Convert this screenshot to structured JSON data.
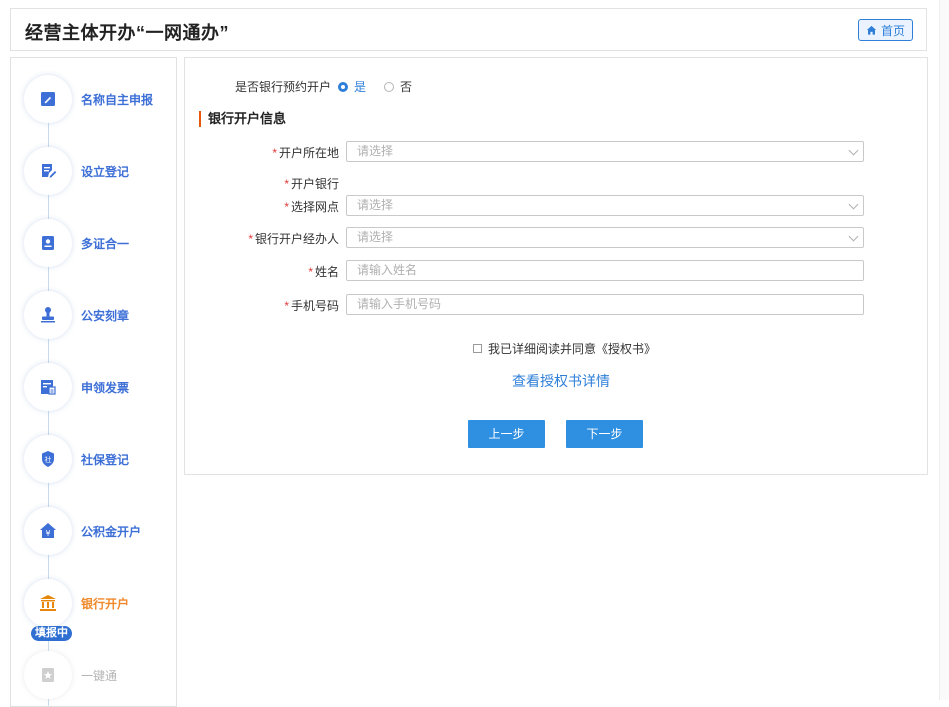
{
  "header": {
    "title": "经营主体开办“一网通办”",
    "home_label": "首页"
  },
  "sidebar": {
    "steps": [
      {
        "label": "名称自主申报",
        "icon": "name-declare-icon"
      },
      {
        "label": "设立登记",
        "icon": "edit-form-icon"
      },
      {
        "label": "多证合一",
        "icon": "certificate-icon"
      },
      {
        "label": "公安刻章",
        "icon": "stamp-icon"
      },
      {
        "label": "申领发票",
        "icon": "invoice-icon"
      },
      {
        "label": "社保登记",
        "icon": "social-security-icon"
      },
      {
        "label": "公积金开户",
        "icon": "housing-fund-icon"
      },
      {
        "label": "银行开户",
        "icon": "bank-icon"
      },
      {
        "label": "一键通",
        "icon": "one-click-icon"
      }
    ],
    "active_index": 7,
    "filling_badge": "填报中",
    "colors": {
      "accent": "#3d6fd6",
      "active": "#f0892c"
    }
  },
  "form": {
    "prebook": {
      "question": "是否银行预约开户",
      "yes": "是",
      "no": "否",
      "selected": "是"
    },
    "section_title": "银行开户信息",
    "fields": {
      "location": {
        "label": "开户所在地",
        "placeholder": "请选择"
      },
      "bank": {
        "label": "开户银行"
      },
      "branch": {
        "label": "选择网点",
        "placeholder": "请选择"
      },
      "agent": {
        "label": "银行开户经办人",
        "placeholder": "请选择"
      },
      "name": {
        "label": "姓名",
        "placeholder": "请输入姓名"
      },
      "phone": {
        "label": "手机号码",
        "placeholder": "请输入手机号码"
      }
    },
    "required_mark": "*",
    "agree_text": "我已详细阅读并同意《授权书》",
    "view_auth_link": "查看授权书详情",
    "prev_button": "上一步",
    "next_button": "下一步"
  }
}
